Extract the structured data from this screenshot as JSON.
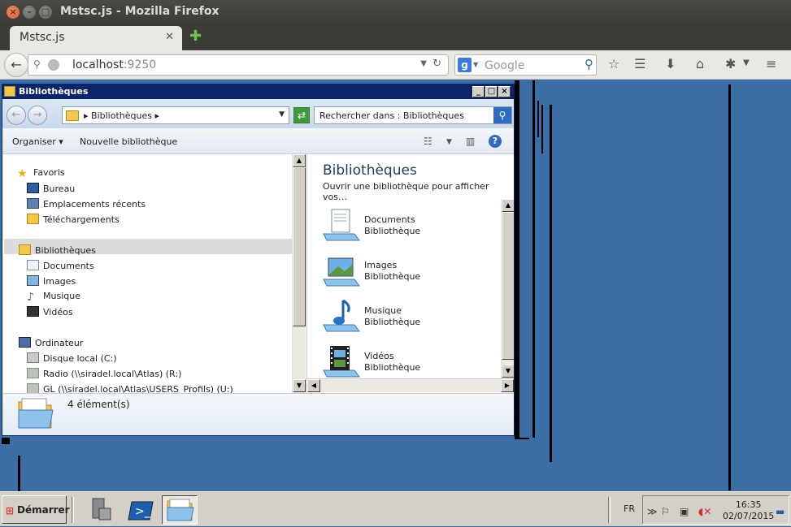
{
  "browser": {
    "window_title": "Mstsc.js - Mozilla Firefox",
    "tab_title": "Mstsc.js",
    "url_host": "localhost",
    "url_port": ":9250",
    "search_placeholder": "Google"
  },
  "explorer": {
    "title": "Bibliothèques",
    "breadcrumb": "Bibliothèques",
    "search_placeholder": "Rechercher dans : Bibliothèques",
    "toolbar": {
      "organize": "Organiser",
      "new_library": "Nouvelle bibliothèque"
    },
    "nav": {
      "favorites": "Favoris",
      "desktop": "Bureau",
      "recent": "Emplacements récents",
      "downloads": "Téléchargements",
      "libraries": "Bibliothèques",
      "documents": "Documents",
      "images": "Images",
      "music": "Musique",
      "videos": "Vidéos",
      "computer": "Ordinateur",
      "local_disk": "Disque local (C:)",
      "radio": "Radio (\\\\siradel.local\\Atlas) (R:)",
      "gl": "GL (\\\\siradel.local\\Atlas\\USERS_Profils) (U:)"
    },
    "content": {
      "heading": "Bibliothèques",
      "subheading": "Ouvrir une bibliothèque pour afficher vos…",
      "libraries": [
        {
          "name": "Documents",
          "type": "Bibliothèque"
        },
        {
          "name": "Images",
          "type": "Bibliothèque"
        },
        {
          "name": "Musique",
          "type": "Bibliothèque"
        },
        {
          "name": "Vidéos",
          "type": "Bibliothèque"
        }
      ]
    },
    "details": "4 élément(s)"
  },
  "taskbar": {
    "start": "Démarrer",
    "language": "FR",
    "time": "16:35",
    "date": "02/07/2015"
  }
}
